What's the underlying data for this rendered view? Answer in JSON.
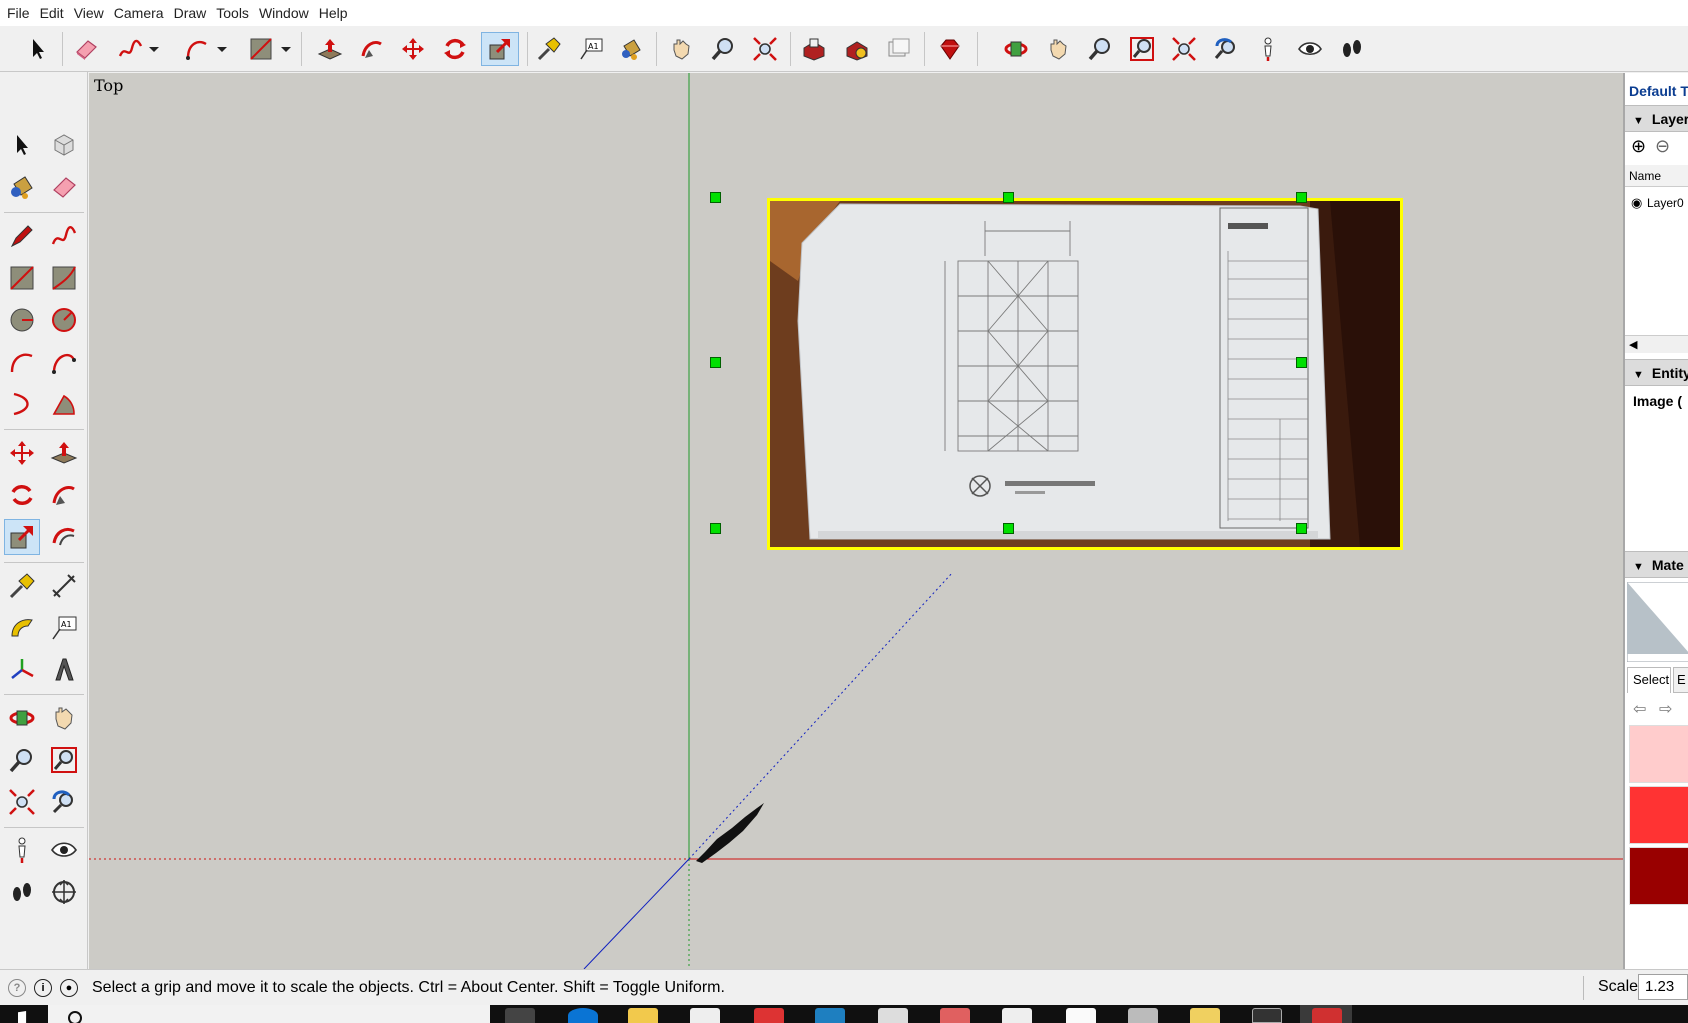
{
  "menu": [
    "File",
    "Edit",
    "View",
    "Camera",
    "Draw",
    "Tools",
    "Window",
    "Help"
  ],
  "top_toolbar": {
    "icons": [
      "select-icon",
      "eraser-icon",
      "freehand-icon",
      "arc-icon",
      "rectangle-icon",
      "push-pull-icon",
      "follow-me-icon",
      "move-icon",
      "rotate-icon",
      "scale-icon",
      "tape-measure-icon",
      "text-icon",
      "paint-bucket-icon",
      "pan-icon",
      "zoom-icon",
      "zoom-extents-icon",
      "warehouse-icon",
      "extension-warehouse-icon",
      "layout-icon",
      "ruby-icon",
      "orbit-icon",
      "pan-hand-icon",
      "zoom-icon-2",
      "zoom-window-icon",
      "zoom-extents-icon-2",
      "previous-view-icon",
      "position-camera-icon",
      "look-around-icon",
      "walk-icon"
    ],
    "active": "scale-icon"
  },
  "left_toolbar": {
    "active": "scale-icon"
  },
  "viewport": {
    "view_name": "Top",
    "background": "#cccbc6",
    "selection_color": "#ffff00",
    "grip_color": "#00e000"
  },
  "right_panel": {
    "tray_title": "Default T",
    "layers": {
      "header": "Layer",
      "column": "Name",
      "row": "Layer0"
    },
    "entity": {
      "header": "Entity",
      "type": "Image ("
    },
    "materials": {
      "header": "Mate",
      "select_tab": "Select",
      "edit_tab_partial": "E"
    },
    "swatches": [
      "#ffcccc",
      "#ff3333",
      "#990000"
    ]
  },
  "statusbar": {
    "message": "Select a grip and move it to scale the objects. Ctrl = About Center. Shift = Toggle Uniform.",
    "scale_label": "Scale",
    "scale_value": "1.23"
  }
}
